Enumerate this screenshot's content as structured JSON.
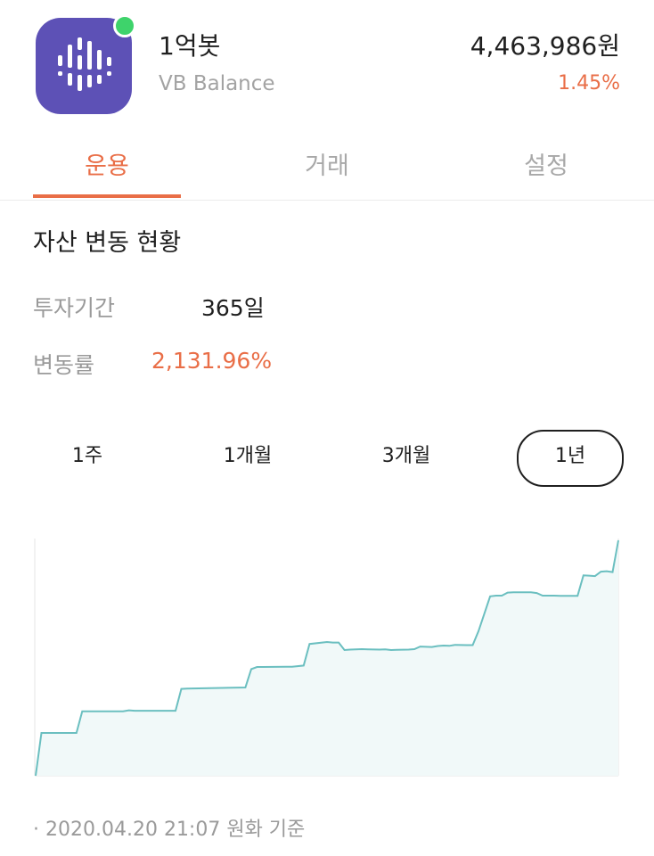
{
  "bot": {
    "name": "1억봇",
    "strategy": "VB Balance",
    "balance": "4,463,986원",
    "change_pct": "1.45%",
    "icon": "waveform-logo-icon",
    "status": "online",
    "accent_color": "#e96e47",
    "icon_color": "#5d51b6"
  },
  "tabs": [
    {
      "label": "운용",
      "active": true
    },
    {
      "label": "거래",
      "active": false
    },
    {
      "label": "설정",
      "active": false
    }
  ],
  "section": {
    "title": "자산 변동 현황",
    "period_label": "투자기간",
    "period_value": "365일",
    "change_label": "변동률",
    "change_value": "2,131.96%"
  },
  "range_buttons": [
    {
      "label": "1주",
      "selected": false
    },
    {
      "label": "1개월",
      "selected": false
    },
    {
      "label": "3개월",
      "selected": false
    },
    {
      "label": "1년",
      "selected": true
    }
  ],
  "chart_data": {
    "type": "area",
    "title": "",
    "xlabel": "",
    "ylabel": "",
    "grid": false,
    "line_color": "#6bbfc0",
    "fill_color": "#f1f9f9",
    "x": [
      0,
      1,
      7,
      8,
      15,
      16,
      17,
      24,
      25,
      26,
      36,
      37,
      38,
      39,
      43,
      44,
      46,
      47,
      50,
      51,
      52,
      53,
      54,
      55,
      56,
      57,
      59,
      60,
      61,
      62,
      64,
      65,
      66,
      68,
      69,
      70,
      71,
      72,
      74,
      75,
      76,
      78,
      79,
      80,
      81,
      82,
      85,
      86,
      87,
      88,
      89,
      90,
      93,
      94,
      95,
      96,
      97,
      98,
      99,
      100
    ],
    "values": [
      0,
      18.2,
      18.2,
      27.4,
      27.4,
      27.8,
      27.6,
      27.6,
      36.9,
      37.0,
      37.5,
      45.3,
      46.2,
      46.2,
      46.3,
      46.3,
      46.8,
      56.0,
      56.8,
      56.6,
      56.6,
      53.4,
      53.6,
      53.7,
      53.8,
      53.7,
      53.6,
      53.7,
      53.4,
      53.5,
      53.6,
      53.8,
      54.9,
      54.7,
      55.1,
      55.3,
      55.2,
      55.6,
      55.5,
      55.5,
      61.4,
      76.2,
      76.5,
      76.5,
      77.8,
      77.9,
      77.9,
      77.6,
      76.5,
      76.5,
      76.5,
      76.4,
      76.4,
      85.1,
      85.0,
      84.8,
      86.7,
      86.9,
      86.5,
      100
    ],
    "ylim": [
      0,
      100
    ]
  },
  "footnote": "· 2020.04.20 21:07 원화 기준"
}
